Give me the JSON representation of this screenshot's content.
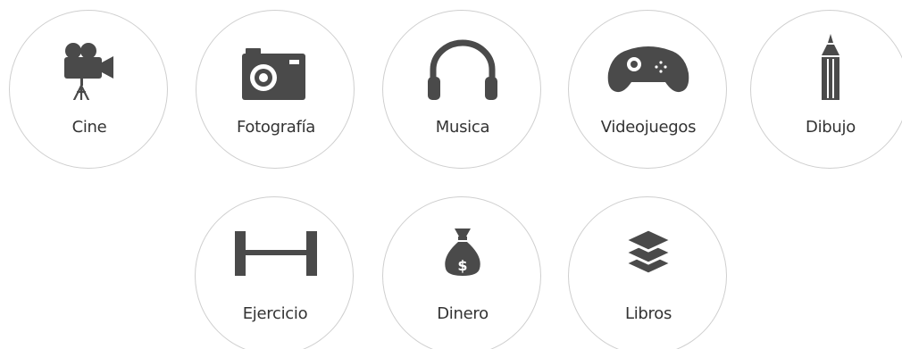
{
  "colors": {
    "icon": "#4a4a4a",
    "border": "#cfcfcf",
    "text": "#333333",
    "background": "#ffffff"
  },
  "items": [
    {
      "label": "Cine",
      "icon": "film-camera-icon"
    },
    {
      "label": "Fotografía",
      "icon": "photo-camera-icon"
    },
    {
      "label": "Musica",
      "icon": "headphones-icon"
    },
    {
      "label": "Videojuegos",
      "icon": "gamepad-icon"
    },
    {
      "label": "Dibujo",
      "icon": "pencil-icon"
    },
    {
      "label": "Ejercicio",
      "icon": "barbell-icon"
    },
    {
      "label": "Dinero",
      "icon": "money-bag-icon"
    },
    {
      "label": "Libros",
      "icon": "layers-icon"
    }
  ]
}
